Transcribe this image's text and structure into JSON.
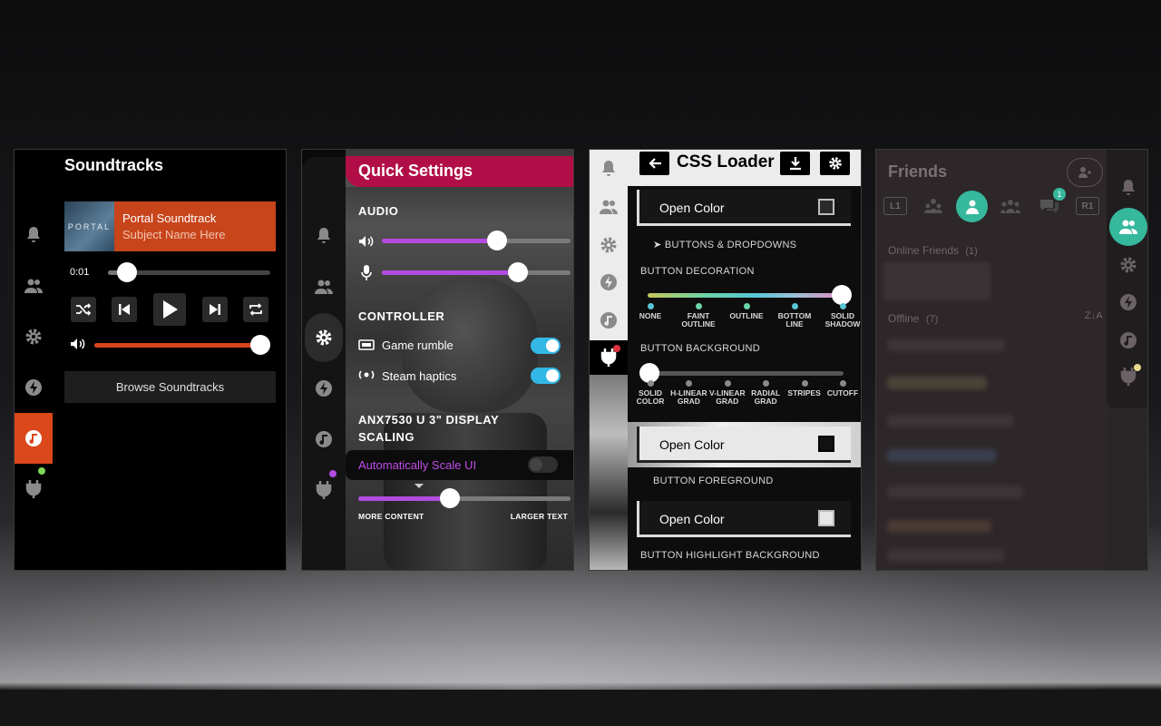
{
  "colors": {
    "steam_orange": "#d9471b",
    "qs_header": "#b10e47",
    "slider_purple": "#b44be0",
    "toggle_blue": "#33b8e6",
    "friends_teal": "#36b89c",
    "notif_red": "#e0303d",
    "notif_green": "#7ed957",
    "notif_purple": "#b44be0",
    "notif_yellow": "#e8d98c"
  },
  "soundtracks": {
    "title": "Soundtracks",
    "album_art_text": "PORTAL",
    "now_playing": {
      "track": "Portal Soundtrack",
      "subtitle": "Subject Name Here"
    },
    "time": "0:01",
    "browse_label": "Browse Soundtracks",
    "nav_icons": [
      "bell-icon",
      "friends-icon",
      "gear-icon",
      "power-icon",
      "music-icon",
      "plug-icon"
    ],
    "active_nav": "music-icon",
    "progress": 0.12,
    "volume": 0.95
  },
  "quick_settings": {
    "title": "Quick Settings",
    "audio_heading": "AUDIO",
    "volume_level": 0.61,
    "mic_level": 0.72,
    "controller_heading": "CONTROLLER",
    "game_rumble_label": "Game rumble",
    "steam_haptics_label": "Steam haptics",
    "game_rumble_on": true,
    "steam_haptics_on": true,
    "display_heading": "ANX7530 U 3\" DISPLAY SCALING",
    "auto_scale_label": "Automatically Scale UI",
    "auto_scale_on": false,
    "scale_level": 0.43,
    "scale_min_label": "MORE CONTENT",
    "scale_max_label": "LARGER TEXT"
  },
  "css_loader": {
    "title": "CSS Loader",
    "open_color_label": "Open Color",
    "buttons_dropdowns": "➤ BUTTONS & DROPDOWNS",
    "button_decoration": "BUTTON DECORATION",
    "decoration_ticks": [
      "NONE",
      "FAINT OUTLINE",
      "OUTLINE",
      "BOTTOM LINE",
      "SOLID SHADOW"
    ],
    "decoration_selected": 4,
    "button_background": "BUTTON BACKGROUND",
    "background_ticks": [
      "SOLID COLOR",
      "H-LINEAR GRAD",
      "V-LINEAR GRAD",
      "RADIAL GRAD",
      "STRIPES",
      "CUTOFF"
    ],
    "background_selected": 0,
    "button_foreground": "BUTTON FOREGROUND",
    "button_highlight_background": "BUTTON HIGHLIGHT BACKGROUND",
    "swatch_colors": [
      "#2a2a2a",
      "#111111",
      "#e6e6e6"
    ]
  },
  "friends": {
    "title": "Friends",
    "l1": "L1",
    "r1": "R1",
    "chat_badge": "1",
    "online_label": "Online Friends",
    "online_count": "(1)",
    "offline_label": "Offline",
    "offline_count": "(7)",
    "sort_label": "Z↓A"
  }
}
